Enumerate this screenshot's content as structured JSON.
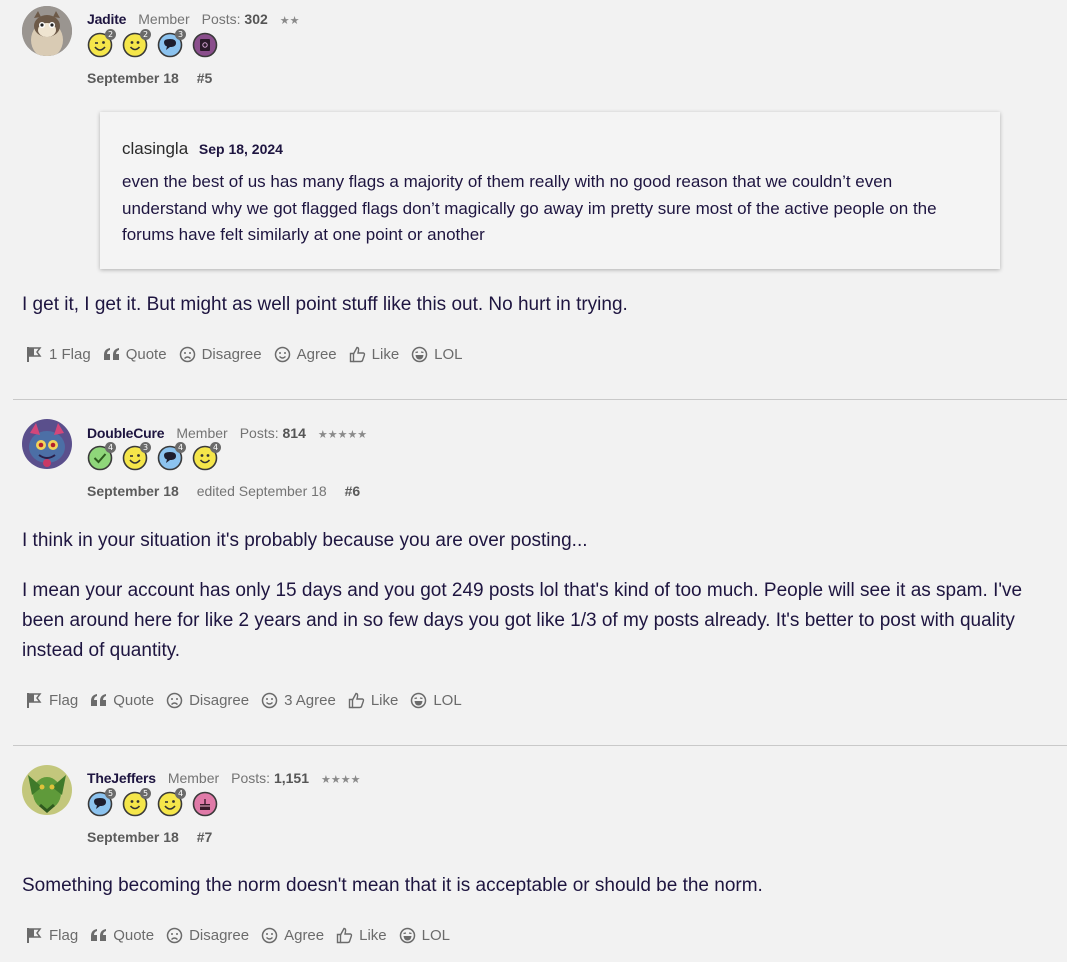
{
  "posts": [
    {
      "username": "Jadite",
      "role": "Member",
      "posts_label": "Posts:",
      "posts_count": "302",
      "stars": "★★",
      "badges": [
        {
          "icon": "wink-badge-icon",
          "count": "2",
          "color": "#f5e64a"
        },
        {
          "icon": "smile-badge-icon",
          "count": "2",
          "color": "#f5e64a"
        },
        {
          "icon": "comment-badge-icon",
          "count": "3",
          "color": "#8cc3ef"
        },
        {
          "icon": "notebook-badge-icon",
          "count": "",
          "color": "#8a4e8c"
        }
      ],
      "date": "September 18",
      "edited": "",
      "number": "#5",
      "quote": {
        "author": "clasingla",
        "date": "Sep 18, 2024",
        "text": "even the best of us has many flags a majority of them really with no good reason that we couldn’t even understand why we got flagged flags don’t magically go away im pretty sure most of the active people on the forums have felt similarly at one point or another"
      },
      "paragraphs": [
        "I get it, I get it. But might as well point stuff like this out. No hurt in trying."
      ],
      "actions": [
        "1 Flag",
        "Quote",
        "Disagree",
        "Agree",
        "Like",
        "LOL"
      ]
    },
    {
      "username": "DoubleCure",
      "role": "Member",
      "posts_label": "Posts:",
      "posts_count": "814",
      "stars": "★★★★★",
      "badges": [
        {
          "icon": "check-badge-icon",
          "count": "4",
          "color": "#8fd67a"
        },
        {
          "icon": "wink-badge-icon",
          "count": "3",
          "color": "#f5e64a"
        },
        {
          "icon": "comment-badge-icon",
          "count": "4",
          "color": "#8cc3ef"
        },
        {
          "icon": "smile-badge-icon",
          "count": "4",
          "color": "#f5e64a"
        }
      ],
      "date": "September 18",
      "edited": "edited September 18",
      "number": "#6",
      "paragraphs": [
        "I think in your situation it's probably because you are over posting...",
        "I mean your account has only 15 days and you got 249 posts lol that's kind of too much. People will see it as spam. I've been around here for like 2 years and in so few days you got like 1/3 of my posts already. It's better to post with quality instead of quantity."
      ],
      "actions": [
        "Flag",
        "Quote",
        "Disagree",
        "3 Agree",
        "Like",
        "LOL"
      ]
    },
    {
      "username": "TheJeffers",
      "role": "Member",
      "posts_label": "Posts:",
      "posts_count": "1,151",
      "stars": "★★★★",
      "badges": [
        {
          "icon": "comment-badge-icon",
          "count": "5",
          "color": "#8cc3ef"
        },
        {
          "icon": "smile-badge-icon",
          "count": "5",
          "color": "#f5e64a"
        },
        {
          "icon": "wink-badge-icon",
          "count": "4",
          "color": "#f5e64a"
        },
        {
          "icon": "cake-badge-icon",
          "count": "",
          "color": "#e07aa8"
        }
      ],
      "date": "September 18",
      "edited": "",
      "number": "#7",
      "paragraphs": [
        "Something becoming the norm doesn't mean that it is acceptable or should be the norm."
      ],
      "actions": [
        "Flag",
        "Quote",
        "Disagree",
        "Agree",
        "Like",
        "LOL"
      ]
    }
  ]
}
